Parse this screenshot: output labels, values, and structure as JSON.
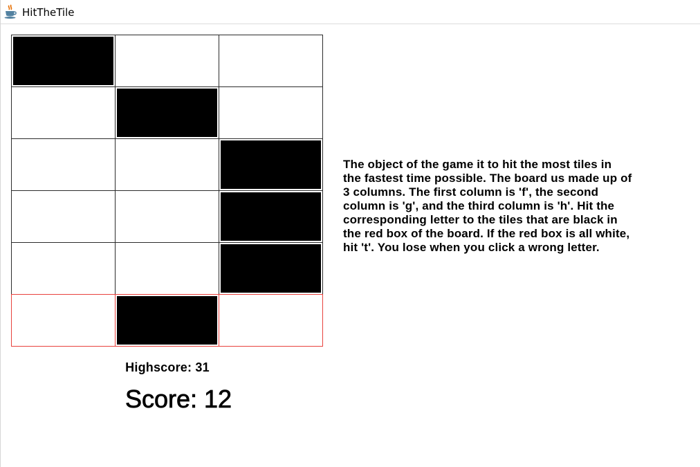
{
  "window": {
    "title": "HitTheTile",
    "icon": "java-cup-icon"
  },
  "board": {
    "columns": 3,
    "rows": 6,
    "column_keys": [
      "f",
      "g",
      "h"
    ],
    "tiles": [
      [
        1,
        0,
        0
      ],
      [
        0,
        1,
        0
      ],
      [
        0,
        0,
        1
      ],
      [
        0,
        0,
        1
      ],
      [
        0,
        0,
        1
      ],
      [
        0,
        1,
        0
      ]
    ],
    "red_box_row": 5,
    "colors": {
      "tile_black": "#000000",
      "tile_white": "#ffffff",
      "grid": "#2b2b2b",
      "red_box": "#e8413c"
    }
  },
  "highscore": "Highscore: 31",
  "score": "Score: 12",
  "instructions": {
    "lines": [
      "The object of the game it to hit the most tiles in",
      "the fastest time possible. The board us made up of",
      "3 columns. The first column is 'f', the second",
      "column is 'g', and the third column is 'h'. Hit the",
      "corresponding letter to the tiles that are black in",
      "the red box of the board. If the red box is all white,",
      "hit 't'. You lose when you click a wrong letter."
    ]
  }
}
